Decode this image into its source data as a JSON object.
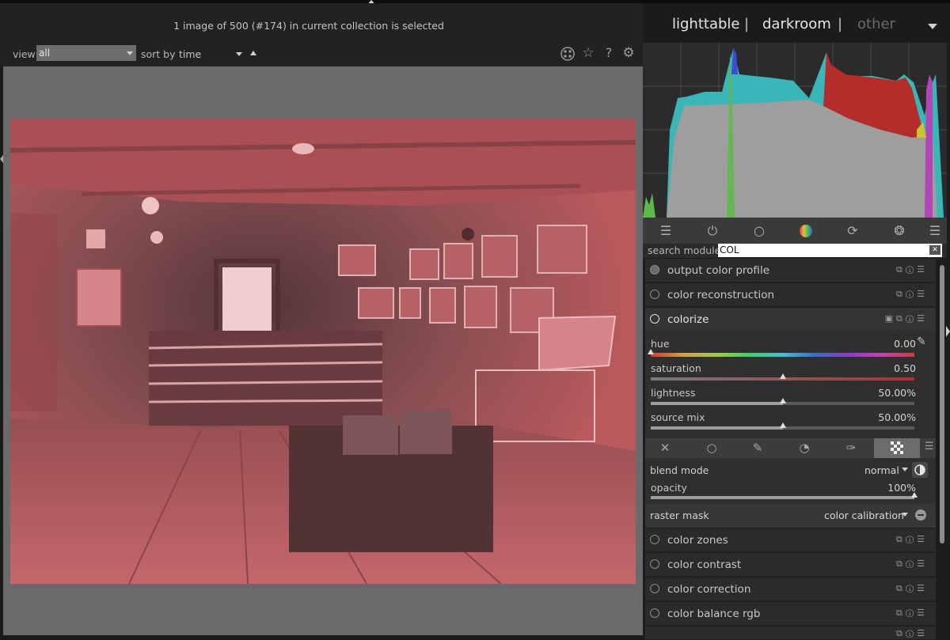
{
  "header": {
    "status_text": "1 image of 500 (#174) in current collection is selected"
  },
  "filter_bar": {
    "view_label": "view",
    "view_value": "all",
    "sort_label": "sort by",
    "sort_value": "time"
  },
  "top_right_icons": [
    "grouping-icon",
    "star-icon",
    "help-icon",
    "gear-icon"
  ],
  "views_nav": {
    "lighttable": "lighttable",
    "sep1": "|",
    "darkroom": "darkroom",
    "sep2": "|",
    "other": "other"
  },
  "histogram": {
    "colors": {
      "background": "#2b2b2b",
      "grey": "#9e9e9e",
      "cyan": "#3bb6b8",
      "red": "#b32d2a",
      "green": "#5fb84a",
      "magenta": "#b146b5",
      "blue": "#3c4bd8",
      "yellow": "#c9c33a"
    }
  },
  "module_group_tabs": [
    "quick-access-icon",
    "active-modules-icon",
    "base-icon",
    "color-icon",
    "correct-icon",
    "effect-icon",
    "presets-menu-icon"
  ],
  "search": {
    "label": "search module",
    "value": "COL"
  },
  "modules_top": [
    {
      "name": "output color profile"
    },
    {
      "name": "color reconstruction"
    },
    {
      "name": "colorize"
    }
  ],
  "colorize": {
    "sliders": [
      {
        "label": "hue",
        "value": "0.00",
        "level": 0.0
      },
      {
        "label": "saturation",
        "value": "0.50",
        "level": 0.5
      },
      {
        "label": "lightness",
        "value": "50.00%",
        "level": 0.5
      },
      {
        "label": "source mix",
        "value": "50.00%",
        "level": 0.5
      }
    ]
  },
  "blending": {
    "tabs": [
      "off-icon",
      "uniformly-icon",
      "drawn-mask-icon",
      "parametric-mask-icon",
      "drawn-parametric-icon",
      "raster-mask-icon"
    ],
    "blend_mode_label": "blend mode",
    "blend_mode_value": "normal",
    "opacity_label": "opacity",
    "opacity_value": "100%",
    "opacity_level": 1.0,
    "raster_mask_label": "raster mask",
    "raster_mask_value": "color calibration"
  },
  "modules_bottom": [
    {
      "name": "color zones"
    },
    {
      "name": "color contrast"
    },
    {
      "name": "color correction"
    },
    {
      "name": "color balance rgb"
    }
  ],
  "colors": {
    "accent_tint": "#c85a5e",
    "panel_bg": "#2b2b2b",
    "canvas_bg": "#6a6a6a"
  }
}
